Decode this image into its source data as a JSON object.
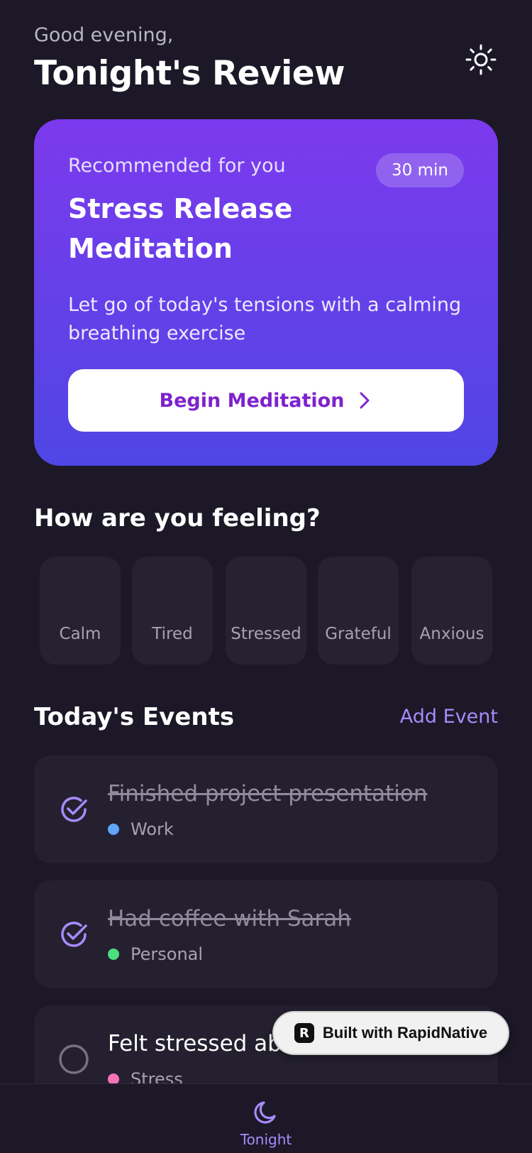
{
  "header": {
    "greeting": "Good evening,",
    "title": "Tonight's Review",
    "theme_icon": "sun-icon"
  },
  "recommendation": {
    "label": "Recommended for you",
    "duration": "30 min",
    "title": "Stress Release Meditation",
    "description": "Let go of today's tensions with a calming breathing exercise",
    "button_label": "Begin Meditation",
    "button_icon": "chevron-right-icon",
    "gradient_colors": [
      "#7c3aed",
      "#4f46e5"
    ]
  },
  "mood": {
    "title": "How are you feeling?",
    "options": [
      {
        "label": "Calm"
      },
      {
        "label": "Tired"
      },
      {
        "label": "Stressed"
      },
      {
        "label": "Grateful"
      },
      {
        "label": "Anxious"
      }
    ]
  },
  "events": {
    "title": "Today's Events",
    "add_label": "Add Event",
    "items": [
      {
        "title": "Finished project presentation",
        "tag": "Work",
        "tag_color": "#60a5fa",
        "done": true
      },
      {
        "title": "Had coffee with Sarah",
        "tag": "Personal",
        "tag_color": "#4ade80",
        "done": true
      },
      {
        "title": "Felt stressed abo",
        "tag": "Stress",
        "tag_color": "#f472b6",
        "done": false
      }
    ]
  },
  "badge": {
    "text": "Built with RapidNative",
    "logo": "R"
  },
  "nav": {
    "tabs": [
      {
        "label": "Tonight",
        "icon": "moon-icon",
        "active": true
      }
    ]
  },
  "colors": {
    "background": "#1c1827",
    "card": "#24202f",
    "accent": "#a78bfa"
  }
}
